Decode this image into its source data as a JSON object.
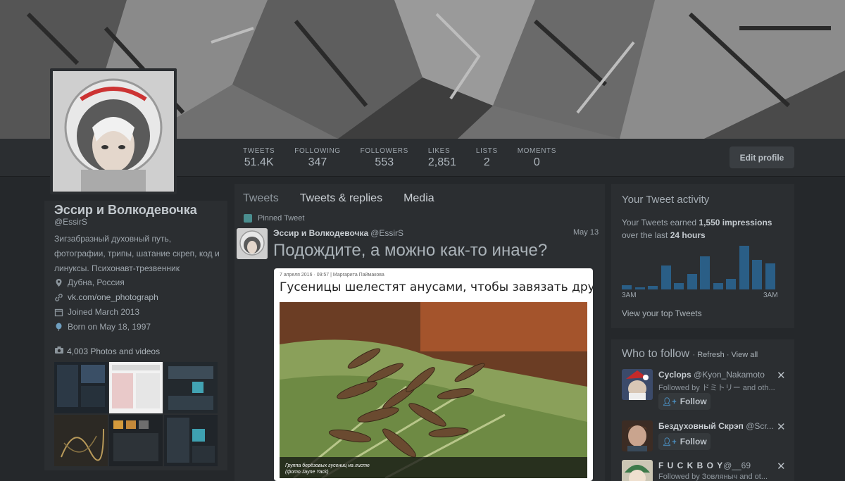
{
  "profile": {
    "name": "Эссир и Волкодевочка",
    "handle": "@EssirS",
    "bio": "Зигзабразный духовный путь, фотографии, трипы, шатание скреп, код и линуксы. Психонавт-трезвенник",
    "location": "Дубна, Россия",
    "website": "vk.com/one_photograph",
    "joined": "Joined March 2013",
    "born": "Born on May 18, 1997",
    "photos_label": "4,003 Photos and videos"
  },
  "stats": [
    {
      "label": "TWEETS",
      "value": "51.4K"
    },
    {
      "label": "FOLLOWING",
      "value": "347"
    },
    {
      "label": "FOLLOWERS",
      "value": "553"
    },
    {
      "label": "LIKES",
      "value": "2,851"
    },
    {
      "label": "LISTS",
      "value": "2"
    },
    {
      "label": "MOMENTS",
      "value": "0"
    }
  ],
  "edit_profile": "Edit profile",
  "tabs": [
    "Tweets",
    "Tweets & replies",
    "Media"
  ],
  "tweet": {
    "pinned_label": "Pinned Tweet",
    "author": "Эссир и Волкодевочка",
    "handle": "@EssirS",
    "date": "May 13",
    "text": "Подождите, а можно как-то иначе?",
    "card_meta": "7 апреля 2016 · 09:57  |  Маргарита Паймакова",
    "card_title": "Гусеницы шелестят анусами, чтобы завязать дружбу",
    "caption_line1": "Группа берёзовых гусениц на листе",
    "caption_line2": "(фото Jayne Yack)"
  },
  "activity": {
    "title": "Your Tweet activity",
    "line1_prefix": "Your Tweets earned ",
    "impressions": "1,550 impressions",
    "line2_prefix": "over the last ",
    "period": "24 hours",
    "axis_left": "3AM",
    "axis_right": "3AM",
    "link": "View your top Tweets",
    "bars": [
      0.1,
      0.05,
      0.08,
      0.55,
      0.14,
      0.36,
      0.76,
      0.15,
      0.25,
      1.0,
      0.67,
      0.6
    ]
  },
  "who_to_follow": {
    "title": "Who to follow",
    "refresh": "Refresh",
    "view_all": "View all",
    "follow_label": "Follow",
    "users": [
      {
        "name": "Cyclops",
        "handle": "@Kyon_Nakamoto",
        "followed_by": "Followed by ドミトリー and oth..."
      },
      {
        "name": "Бездуховный Скрэп",
        "handle": "@Scr...",
        "followed_by": ""
      },
      {
        "name": "F U C K B O Y",
        "handle": "@__69",
        "followed_by": "Followed by Зовляныч and ot..."
      }
    ]
  },
  "colors": {
    "background": "#25282b",
    "panel": "#2b2e31",
    "bar": "#2a5e86",
    "follow_icon": "#4a90c2"
  }
}
